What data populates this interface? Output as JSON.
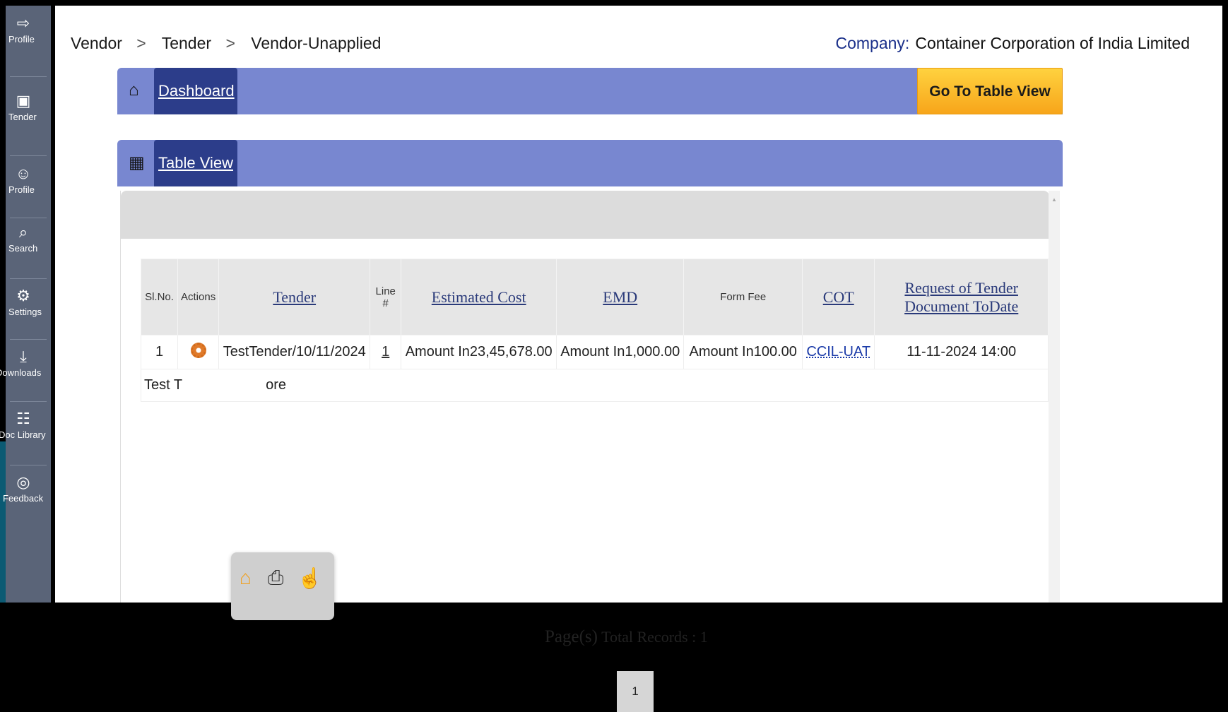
{
  "rail": {
    "items": [
      {
        "label": "Profile",
        "icon": "logout-icon"
      },
      {
        "label": "Tender",
        "icon": "tender-icon"
      },
      {
        "label": "Profile",
        "icon": "user-profile-icon"
      },
      {
        "label": "Search",
        "icon": "search-icon"
      },
      {
        "label": "Settings",
        "icon": "settings-icon"
      },
      {
        "label": "Downloads",
        "icon": "download-icon"
      },
      {
        "label": "Doc Library",
        "icon": "document-icon"
      },
      {
        "label": "Feedback",
        "icon": "feedback-icon"
      }
    ]
  },
  "breadcrumb": {
    "items": [
      "Vendor",
      "Tender",
      "Vendor-Unapplied"
    ],
    "separator": ">"
  },
  "company": {
    "label": "Company:",
    "name": "Container Corporation of India Limited"
  },
  "dashboard_bar": {
    "title": "Dashboard",
    "goto_button": "Go To Table View"
  },
  "table_bar": {
    "title": "Table View"
  },
  "table": {
    "headers": [
      "Sl.No.",
      "Actions",
      "Tender",
      "Line #",
      "Estimated Cost",
      "EMD",
      "Form Fee",
      "COT",
      "Request of Tender Document ToDate"
    ],
    "rows": [
      {
        "sl_no": "1",
        "tender": "TestTender/10/11/2024",
        "line": "1",
        "estimated_cost": "Amount In23,45,678.00",
        "emd": "Amount In1,000.00",
        "form_fee": "Amount In100.00",
        "cot": "CCIL-UAT",
        "request_to_date": "11-11-2024 14:00",
        "description_left": "Test T",
        "description_right": "ore"
      }
    ]
  },
  "popup_actions": [
    {
      "icon": "home-icon"
    },
    {
      "icon": "print-icon"
    },
    {
      "icon": "hand-pointer-icon"
    }
  ],
  "pagination": {
    "pages_label": "Page(s)",
    "total_label": "Total Records : 1",
    "current_page": "1"
  },
  "colors": {
    "bar": "#7887d0",
    "tab_highlight": "#2c3d8a",
    "goto_button": "#f7a51a",
    "rail": "#5a6478"
  }
}
